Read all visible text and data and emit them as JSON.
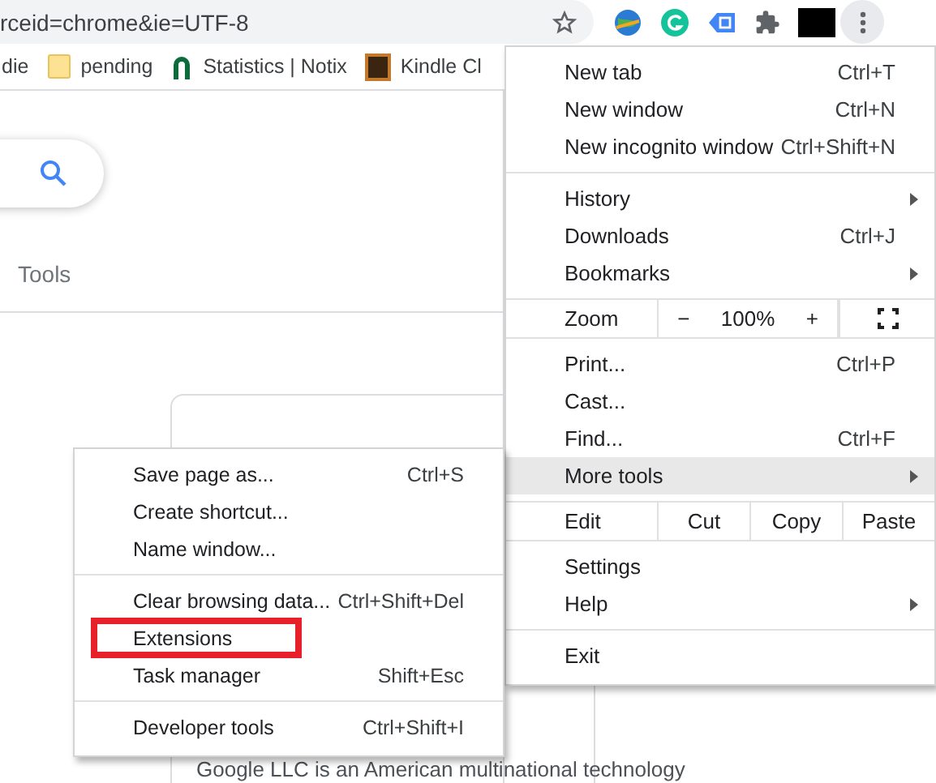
{
  "address_bar": {
    "url": "rceid=chrome&ie=UTF-8"
  },
  "bookmarks": [
    {
      "label": "die",
      "kind": "plain"
    },
    {
      "label": "pending",
      "kind": "folder"
    },
    {
      "label": "Statistics | Notix",
      "kind": "arch"
    },
    {
      "label": "Kindle Cl",
      "kind": "tile"
    }
  ],
  "page": {
    "tools_label": "Tools",
    "snippet": "Google LLC is an American multinational technology"
  },
  "menu": {
    "sections": [
      {
        "items": [
          {
            "kind": "item",
            "label": "New tab",
            "shortcut": "Ctrl+T",
            "submenu": false,
            "selected": false
          },
          {
            "kind": "item",
            "label": "New window",
            "shortcut": "Ctrl+N",
            "submenu": false,
            "selected": false
          },
          {
            "kind": "item",
            "label": "New incognito window",
            "shortcut": "Ctrl+Shift+N",
            "submenu": false,
            "selected": false
          }
        ]
      },
      {
        "items": [
          {
            "kind": "item",
            "label": "History",
            "submenu": true,
            "selected": false
          },
          {
            "kind": "item",
            "label": "Downloads",
            "shortcut": "Ctrl+J",
            "submenu": false,
            "selected": false
          },
          {
            "kind": "item",
            "label": "Bookmarks",
            "submenu": true,
            "selected": false
          }
        ]
      },
      {
        "items": [
          {
            "kind": "zoom",
            "label": "Zoom",
            "minus": "−",
            "value": "100%",
            "plus": "+"
          }
        ]
      },
      {
        "items": [
          {
            "kind": "item",
            "label": "Print...",
            "shortcut": "Ctrl+P",
            "submenu": false,
            "selected": false
          },
          {
            "kind": "item",
            "label": "Cast...",
            "submenu": false,
            "selected": false
          },
          {
            "kind": "item",
            "label": "Find...",
            "shortcut": "Ctrl+F",
            "submenu": false,
            "selected": false
          },
          {
            "kind": "item",
            "label": "More tools",
            "submenu": true,
            "selected": true
          }
        ]
      },
      {
        "items": [
          {
            "kind": "edit",
            "label": "Edit",
            "buttons": [
              "Cut",
              "Copy",
              "Paste"
            ]
          }
        ]
      },
      {
        "items": [
          {
            "kind": "item",
            "label": "Settings",
            "submenu": false,
            "selected": false
          },
          {
            "kind": "item",
            "label": "Help",
            "submenu": true,
            "selected": false
          }
        ]
      },
      {
        "items": [
          {
            "kind": "item",
            "label": "Exit",
            "submenu": false,
            "selected": false
          }
        ]
      }
    ]
  },
  "submenu": {
    "sections": [
      {
        "items": [
          {
            "label": "Save page as...",
            "shortcut": "Ctrl+S",
            "outlined": false
          },
          {
            "label": "Create shortcut...",
            "outlined": false
          },
          {
            "label": "Name window...",
            "outlined": false
          }
        ]
      },
      {
        "items": [
          {
            "label": "Clear browsing data...",
            "shortcut": "Ctrl+Shift+Del",
            "outlined": false
          },
          {
            "label": "Extensions",
            "outlined": true
          },
          {
            "label": "Task manager",
            "shortcut": "Shift+Esc",
            "outlined": false
          }
        ]
      },
      {
        "items": [
          {
            "label": "Developer tools",
            "shortcut": "Ctrl+Shift+I",
            "outlined": false
          }
        ]
      }
    ]
  }
}
